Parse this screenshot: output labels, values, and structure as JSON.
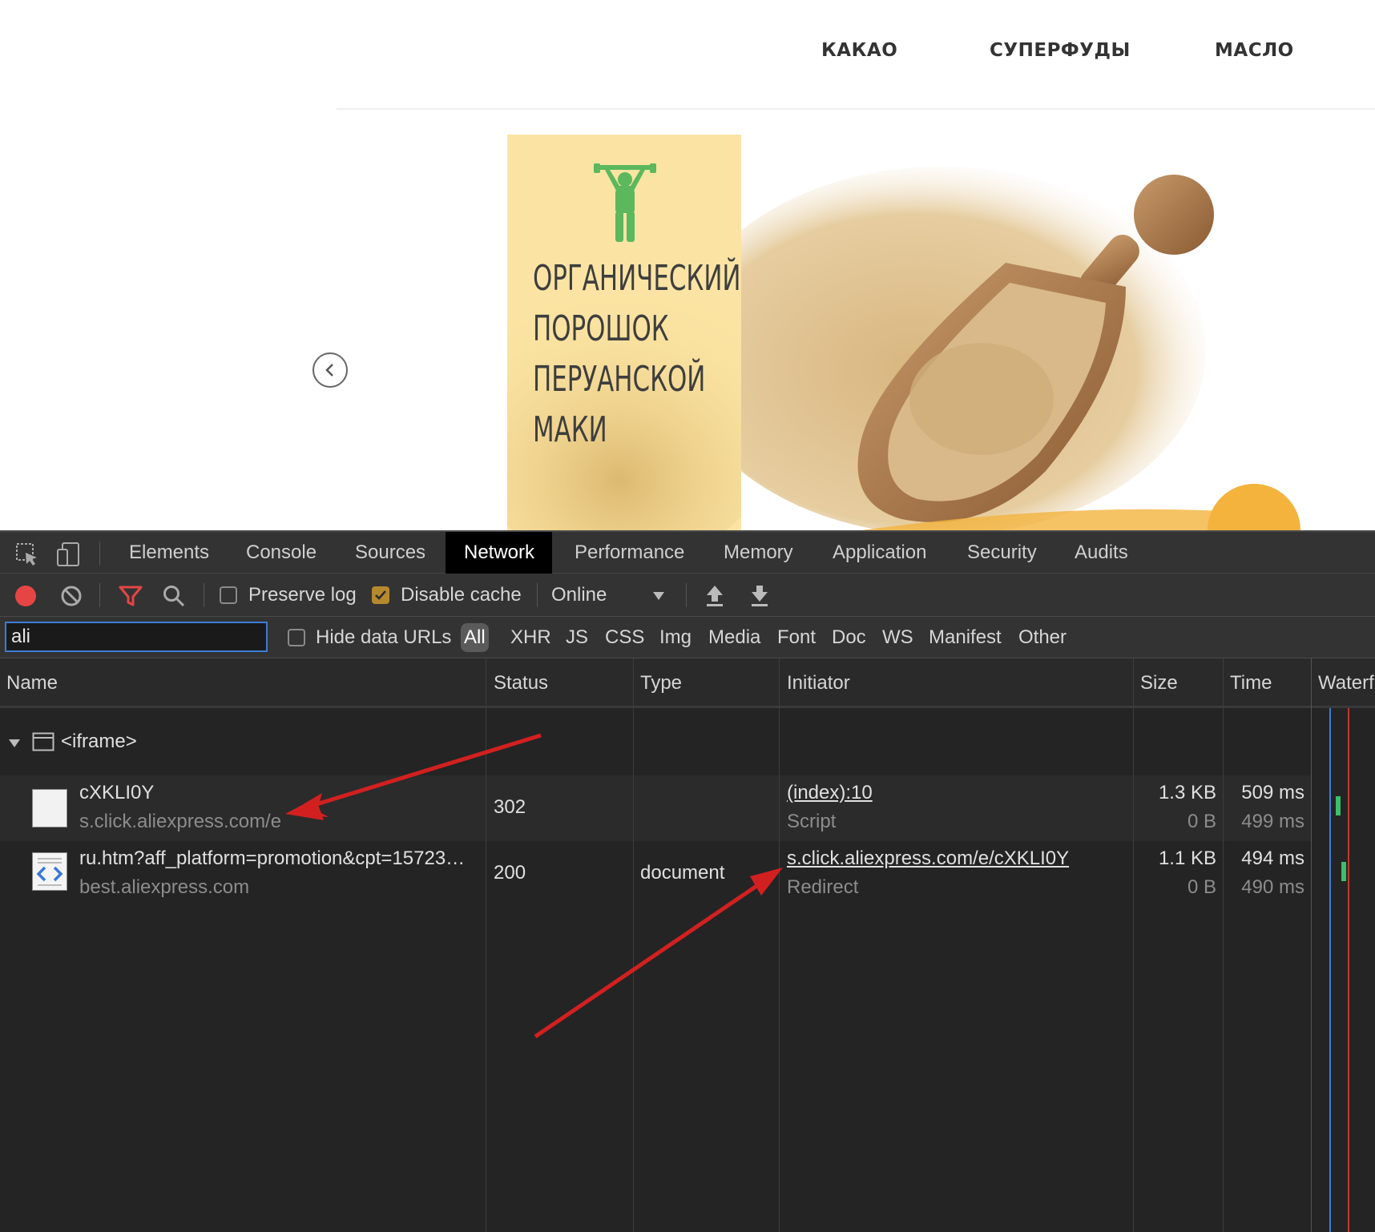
{
  "website": {
    "nav": [
      "КАКАО",
      "СУПЕРФУДЫ",
      "МАСЛО"
    ],
    "banner_title_lines": [
      "ОРГАНИЧЕСКИЙ",
      "ПОРОШОК",
      "ПЕРУАНСКОЙ",
      "МАКИ"
    ],
    "colors": {
      "banner_yellow": "#fbe4a3",
      "icon_green": "#5cb85c",
      "accent_orange": "#f3b33d"
    }
  },
  "devtools": {
    "tabs": [
      "Elements",
      "Console",
      "Sources",
      "Network",
      "Performance",
      "Memory",
      "Application",
      "Security",
      "Audits"
    ],
    "active_tab": "Network",
    "toolbar": {
      "preserve_log": "Preserve log",
      "preserve_log_checked": false,
      "disable_cache": "Disable cache",
      "disable_cache_checked": true,
      "throttling": "Online"
    },
    "filter": {
      "value": "ali",
      "hide_data_urls": "Hide data URLs",
      "types": [
        "All",
        "XHR",
        "JS",
        "CSS",
        "Img",
        "Media",
        "Font",
        "Doc",
        "WS",
        "Manifest",
        "Other"
      ],
      "active_type": "All"
    },
    "columns": [
      "Name",
      "Status",
      "Type",
      "Initiator",
      "Size",
      "Time",
      "Waterf"
    ],
    "group_label": "<iframe>",
    "requests": [
      {
        "name": "cXKLI0Y",
        "domain": "s.click.aliexpress.com/e",
        "status": "302",
        "type": "",
        "initiator": "(index):10",
        "initiator_sub": "Script",
        "size": "1.3 KB",
        "size_sub": "0 B",
        "time": "509 ms",
        "time_sub": "499 ms"
      },
      {
        "name": "ru.htm?aff_platform=promotion&cpt=15723…",
        "domain": "best.aliexpress.com",
        "status": "200",
        "type": "document",
        "initiator": "s.click.aliexpress.com/e/cXKLI0Y",
        "initiator_sub": "Redirect",
        "size": "1.1 KB",
        "size_sub": "0 B",
        "time": "494 ms",
        "time_sub": "490 ms"
      }
    ],
    "colors": {
      "record": "#e64545",
      "filter_icon": "#e64545",
      "annotation_arrow": "#d22020",
      "active_tab_bg": "#000000"
    }
  }
}
